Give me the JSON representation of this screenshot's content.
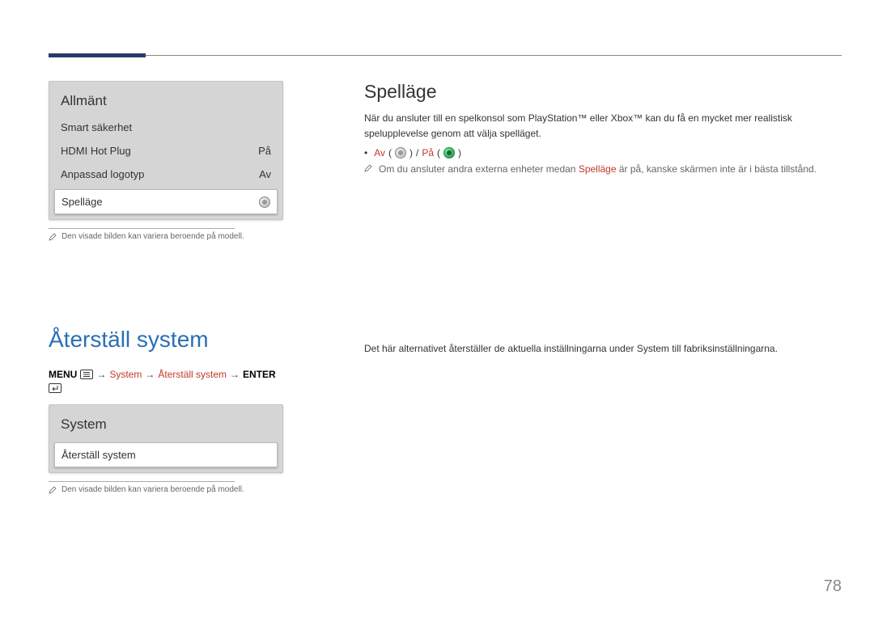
{
  "page_number": "78",
  "section1": {
    "menu": {
      "title": "Allmänt",
      "items": [
        {
          "label": "Smart säkerhet",
          "value": ""
        },
        {
          "label": "HDMI Hot Plug",
          "value": "På"
        },
        {
          "label": "Anpassad logotyp",
          "value": "Av"
        }
      ],
      "selected": {
        "label": "Spelläge"
      }
    },
    "caption": "Den visade bilden kan variera beroende på modell.",
    "right": {
      "heading": "Spelläge",
      "body": "När du ansluter till en spelkonsol som PlayStation™ eller Xbox™ kan du få en mycket mer realistisk spelupplevelse genom att välja spelläget.",
      "option_av": "Av",
      "option_sep": "/",
      "option_pa": "På",
      "note_pre": "Om du ansluter andra externa enheter medan ",
      "note_accent": "Spelläge",
      "note_post": " är på, kanske skärmen inte är i bästa tillstånd."
    }
  },
  "section2": {
    "heading": "Återställ system",
    "breadcrumb": {
      "menu": "MENU",
      "arrow": "→",
      "system": "System",
      "reset": "Återställ system",
      "enter": "ENTER"
    },
    "menu": {
      "title": "System",
      "selected": {
        "label": "Återställ system"
      }
    },
    "caption": "Den visade bilden kan variera beroende på modell.",
    "right": "Det här alternativet återställer de aktuella inställningarna under System till fabriksinställningarna."
  }
}
